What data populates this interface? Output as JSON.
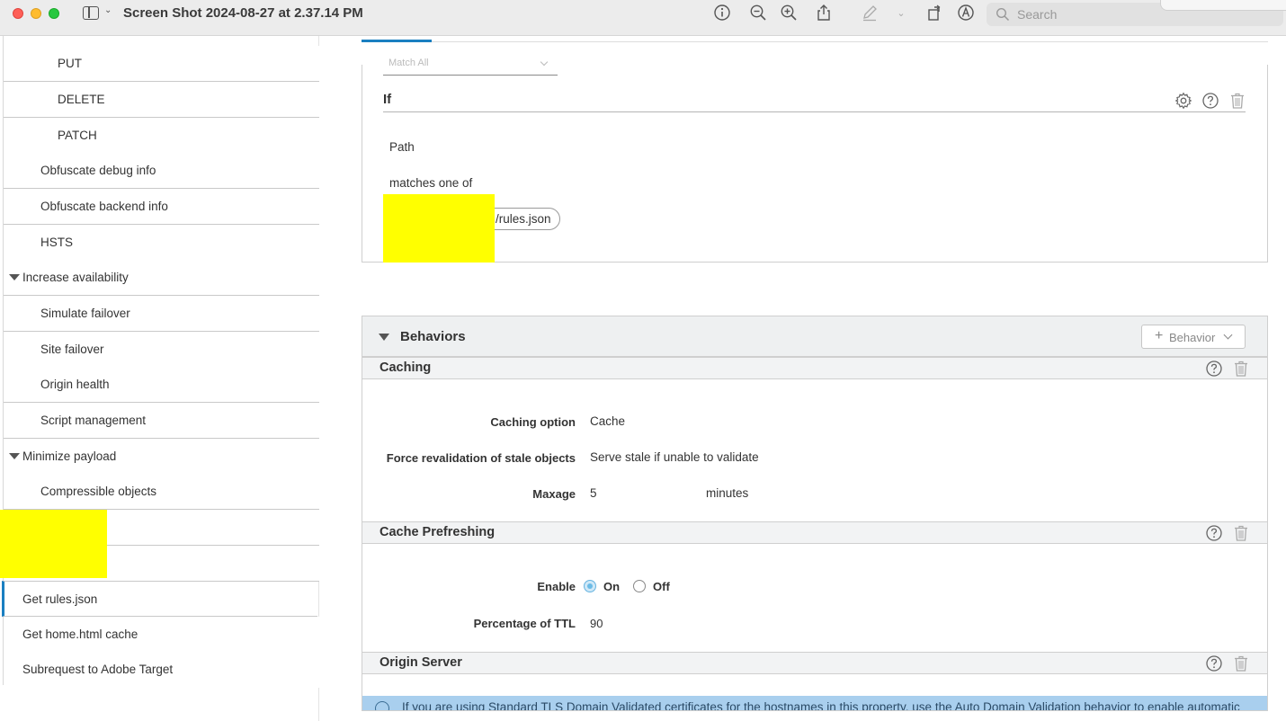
{
  "window": {
    "title": "Screen Shot 2024-08-27 at 2.37.14 PM",
    "search_placeholder": "Search",
    "toolbar_icons": [
      "info-icon",
      "zoom-out-icon",
      "zoom-in-icon",
      "share-icon",
      "markup-pen-icon",
      "chevron-down-icon",
      "rotate-icon",
      "annotate-icon"
    ]
  },
  "sidebar": {
    "items": [
      {
        "label": "PUT",
        "indent": 2
      },
      {
        "label": "DELETE",
        "indent": 2
      },
      {
        "label": "PATCH",
        "indent": 2
      },
      {
        "label": "Obfuscate debug info",
        "indent": 1
      },
      {
        "label": "Obfuscate backend info",
        "indent": 1
      },
      {
        "label": "HSTS",
        "indent": 1
      },
      {
        "label": "Increase availability",
        "indent": 0,
        "expanded": true
      },
      {
        "label": "Simulate failover",
        "indent": 1
      },
      {
        "label": "Site failover",
        "indent": 1
      },
      {
        "label": "Origin health",
        "indent": 1
      },
      {
        "label": "Script management",
        "indent": 1
      },
      {
        "label": "Minimize payload",
        "indent": 0,
        "expanded": true
      },
      {
        "label": "Compressible objects",
        "indent": 1
      },
      {
        "label": "",
        "indent": 0,
        "redacted": true
      },
      {
        "label": "",
        "indent": 0,
        "redacted": true
      },
      {
        "label": "Get rules.json",
        "indent": 0,
        "selected": true
      },
      {
        "label": "Get home.html cache",
        "indent": 0
      },
      {
        "label": "Subrequest to Adobe Target",
        "indent": 0
      }
    ]
  },
  "criteria": {
    "match_select": "Match All",
    "if_title": "If",
    "path_label": "Path",
    "operator_label": "matches one of",
    "value_pill": "/rules.json"
  },
  "behaviors": {
    "title": "Behaviors",
    "add_button": "Behavior",
    "caching": {
      "title": "Caching",
      "option_label": "Caching option",
      "option_value": "Cache",
      "revalidation_label": "Force revalidation of stale objects",
      "revalidation_value": "Serve stale if unable to validate",
      "maxage_label": "Maxage",
      "maxage_value": "5",
      "maxage_unit": "minutes"
    },
    "prefresh": {
      "title": "Cache Prefreshing",
      "enable_label": "Enable",
      "on_label": "On",
      "off_label": "Off",
      "enabled": true,
      "ttl_label": "Percentage of TTL",
      "ttl_value": "90"
    },
    "origin": {
      "title": "Origin Server"
    },
    "info_text": "If you are using Standard TLS Domain Validated certificates for the hostnames in this property, use the Auto Domain Validation behavior to enable automatic"
  },
  "colors": {
    "accent": "#1a7fc1",
    "redaction": "#ffff00",
    "info_bar": "#a9cfee"
  }
}
